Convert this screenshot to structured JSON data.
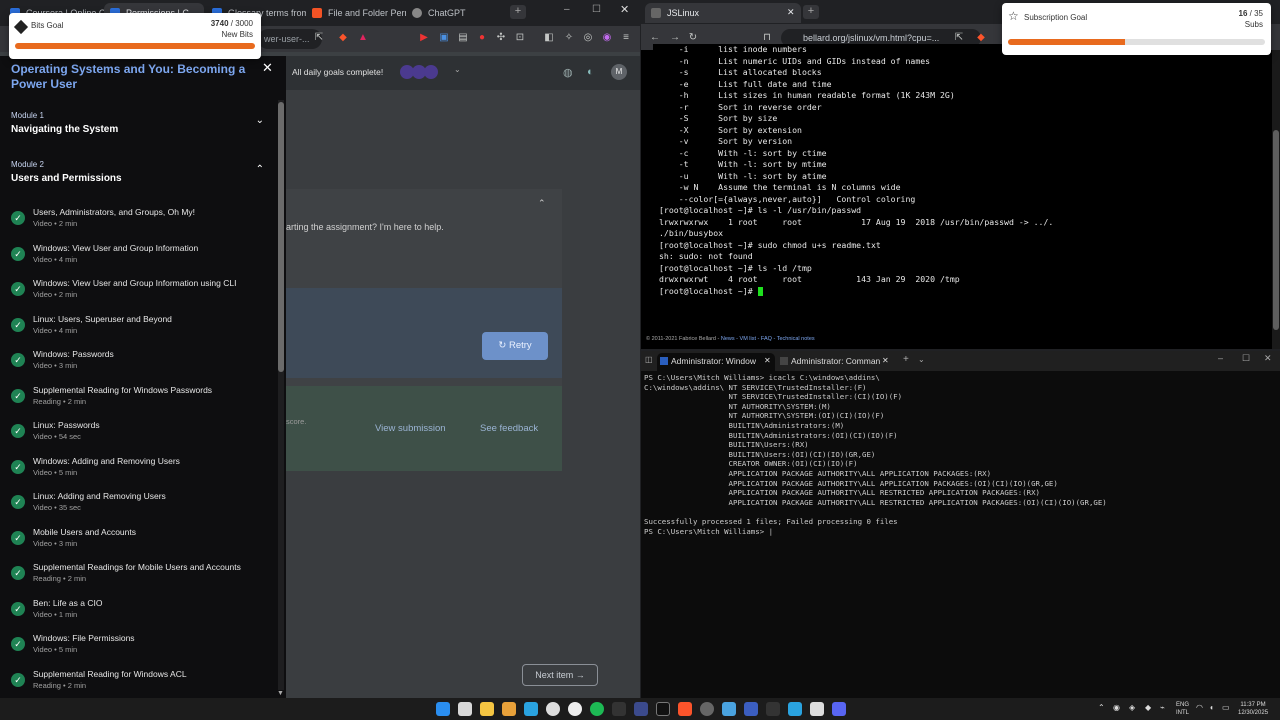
{
  "left_browser": {
    "tabs": [
      {
        "label": "Coursera | Online C"
      },
      {
        "label": "Permissions | C"
      },
      {
        "label": "Glossary terms from"
      },
      {
        "label": "File and Folder Perm"
      },
      {
        "label": "ChatGPT"
      }
    ],
    "omnibox_text": "wer-user-..."
  },
  "bits_goal": {
    "title": "Bits Goal",
    "current": "3740",
    "target": "/ 3000",
    "sub": "New Bits",
    "progress": 1.0
  },
  "subscription_goal": {
    "title": "Subscription Goal",
    "current": "16",
    "target": "/ 35",
    "sub": "Subs",
    "progress": 0.457
  },
  "sidebar": {
    "course_title": "Operating Systems and You: Becoming a Power User",
    "modules": [
      {
        "label": "Module 1",
        "name": "Navigating the System"
      },
      {
        "label": "Module 2",
        "name": "Users and Permissions"
      }
    ],
    "items": [
      {
        "name": "Users, Administrators, and Groups, Oh My!",
        "sub": "Video • 2 min"
      },
      {
        "name": "Windows: View User and Group Information",
        "sub": "Video • 4 min"
      },
      {
        "name": "Windows: View User and Group Information using CLI",
        "sub": "Video • 2 min"
      },
      {
        "name": "Linux: Users, Superuser and Beyond",
        "sub": "Video • 4 min"
      },
      {
        "name": "Windows: Passwords",
        "sub": "Video • 3 min"
      },
      {
        "name": "Supplemental Reading for Windows Passwords",
        "sub": "Reading • 2 min"
      },
      {
        "name": "Linux: Passwords",
        "sub": "Video • 54 sec"
      },
      {
        "name": "Windows: Adding and Removing Users",
        "sub": "Video • 5 min"
      },
      {
        "name": "Linux: Adding and Removing Users",
        "sub": "Video • 35 sec"
      },
      {
        "name": "Mobile Users and Accounts",
        "sub": "Video • 3 min"
      },
      {
        "name": "Supplemental Readings for Mobile Users and Accounts",
        "sub": "Reading • 2 min"
      },
      {
        "name": "Ben: Life as a CIO",
        "sub": "Video • 1 min"
      },
      {
        "name": "Windows: File Permissions",
        "sub": "Video • 5 min"
      },
      {
        "name": "Supplemental Reading for Windows ACL",
        "sub": "Reading • 2 min"
      }
    ]
  },
  "main": {
    "goals_text": "All daily goals complete!",
    "avatar_letter": "M",
    "helper_text": "arting the assignment? I'm here to help.",
    "retry_label": "Retry",
    "score_text": "score.",
    "view_submission": "View submission",
    "see_feedback": "See feedback",
    "next_item": "Next item"
  },
  "jslinux": {
    "tab_title": "JSLinux",
    "url": "bellard.org/jslinux/vm.html?cpu=...",
    "terminal_lines": [
      "    -i      list inode numbers",
      "    -n      List numeric UIDs and GIDs instead of names",
      "    -s      List allocated blocks",
      "    -e      List full date and time",
      "    -h      List sizes in human readable format (1K 243M 2G)",
      "    -r      Sort in reverse order",
      "    -S      Sort by size",
      "    -X      Sort by extension",
      "    -v      Sort by version",
      "    -c      With -l: sort by ctime",
      "    -t      With -l: sort by mtime",
      "    -u      With -l: sort by atime",
      "    -w N    Assume the terminal is N columns wide",
      "    --color[={always,never,auto}]   Control coloring",
      "[root@localhost ~]# ls -l /usr/bin/passwd",
      "lrwxrwxrwx    1 root     root            17 Aug 19  2018 /usr/bin/passwd -> ../.",
      "./bin/busybox",
      "[root@localhost ~]# sudo chmod u+s readme.txt",
      "sh: sudo: not found",
      "[root@localhost ~]# ls -ld /tmp",
      "drwxrwxrwt    4 root     root           143 Jan 29  2020 /tmp",
      "[root@localhost ~]# "
    ],
    "copyright": "© 2011-2021 Fabrice Bellard - ",
    "copyright_links": "News - VM list - FAQ - Technical notes"
  },
  "terminal": {
    "tabs": [
      {
        "label": "Administrator: Window"
      },
      {
        "label": "Administrator: Comman"
      }
    ],
    "lines": [
      "PS C:\\Users\\Mitch Williams> icacls C:\\windows\\addins\\",
      "C:\\windows\\addins\\ NT SERVICE\\TrustedInstaller:(F)",
      "                   NT SERVICE\\TrustedInstaller:(CI)(IO)(F)",
      "                   NT AUTHORITY\\SYSTEM:(M)",
      "                   NT AUTHORITY\\SYSTEM:(OI)(CI)(IO)(F)",
      "                   BUILTIN\\Administrators:(M)",
      "                   BUILTIN\\Administrators:(OI)(CI)(IO)(F)",
      "                   BUILTIN\\Users:(RX)",
      "                   BUILTIN\\Users:(OI)(CI)(IO)(GR,GE)",
      "                   CREATOR OWNER:(OI)(CI)(IO)(F)",
      "                   APPLICATION PACKAGE AUTHORITY\\ALL APPLICATION PACKAGES:(RX)",
      "                   APPLICATION PACKAGE AUTHORITY\\ALL APPLICATION PACKAGES:(OI)(CI)(IO)(GR,GE)",
      "                   APPLICATION PACKAGE AUTHORITY\\ALL RESTRICTED APPLICATION PACKAGES:(RX)",
      "                   APPLICATION PACKAGE AUTHORITY\\ALL RESTRICTED APPLICATION PACKAGES:(OI)(CI)(IO)(GR,GE)",
      "",
      "Successfully processed 1 files; Failed processing 0 files",
      "PS C:\\Users\\Mitch Williams> |"
    ]
  },
  "taskbar": {
    "lang": "ENG",
    "region": "INTL",
    "time": "11:37 PM",
    "date": "12/30/2025"
  }
}
